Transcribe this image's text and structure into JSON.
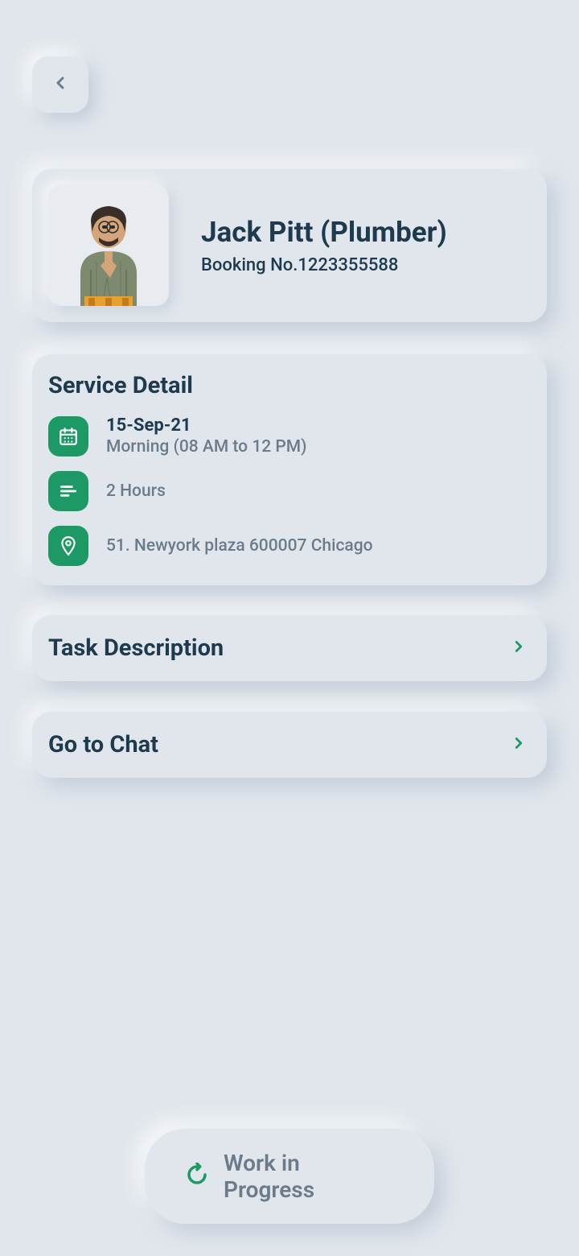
{
  "icons": {
    "back": "chevron-left",
    "calendar": "calendar",
    "list": "list",
    "location": "location-pin",
    "chevron_right": "chevron-right",
    "refresh": "refresh"
  },
  "colors": {
    "accent": "#1d9965",
    "text_primary": "#1e3a4f",
    "text_secondary": "#6b7b8a",
    "background": "#e1e6ec"
  },
  "provider": {
    "name": "Jack Pitt (Plumber)",
    "booking_label": "Booking No.1223355588"
  },
  "service_detail": {
    "title": "Service Detail",
    "date": "15-Sep-21",
    "time_slot": "Morning (08 AM to 12 PM)",
    "duration": "2 Hours",
    "address": "51. Newyork plaza 600007 Chicago"
  },
  "nav": {
    "task_description": "Task Description",
    "go_to_chat": "Go to Chat"
  },
  "status": {
    "label": "Work in Progress"
  }
}
